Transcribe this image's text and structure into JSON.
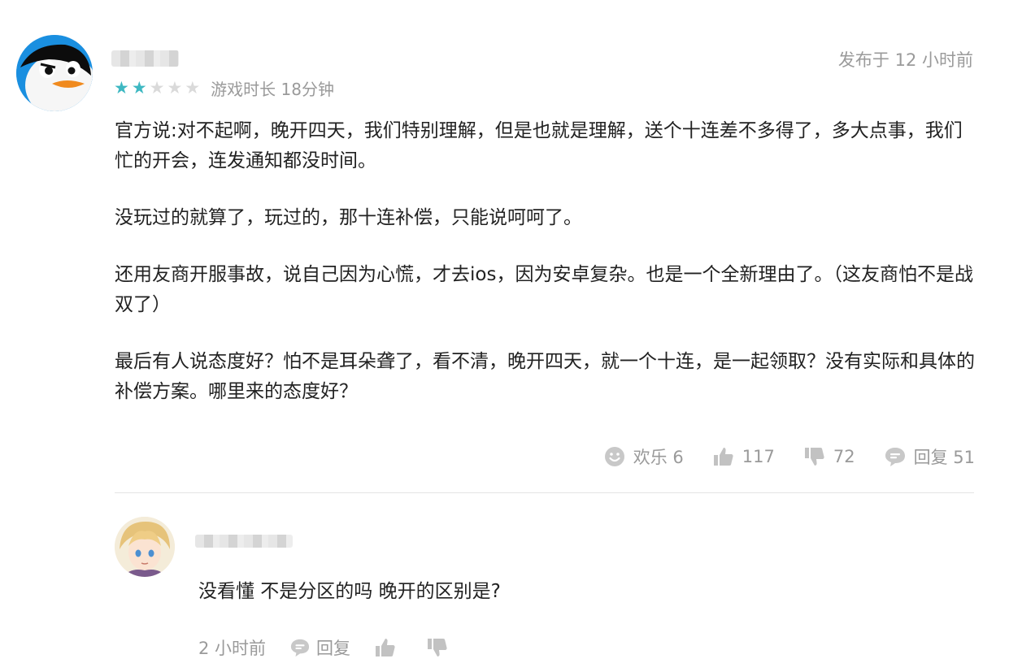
{
  "review": {
    "published": "发布于 12 小时前",
    "rating": {
      "value": 2,
      "max": 5
    },
    "playtime": "游戏时长 18分钟",
    "paragraphs": [
      "官方说:对不起啊，晚开四天，我们特别理解，但是也就是理解，送个十连差不多得了，多大点事，我们忙的开会，连发通知都没时间。",
      "没玩过的就算了，玩过的，那十连补偿，只能说呵呵了。",
      "还用友商开服事故，说自己因为心慌，才去ios，因为安卓复杂。也是一个全新理由了。（这友商怕不是战双了）",
      "最后有人说态度好？怕不是耳朵聋了，看不清，晚开四天，就一个十连，是一起领取？没有实际和具体的补偿方案。哪里来的态度好？"
    ],
    "actions": {
      "funny": "欢乐 6",
      "like": "117",
      "dislike": "72",
      "reply": "回复 51"
    }
  },
  "reply": {
    "text": "没看懂 不是分区的吗 晚开的区别是?",
    "time": "2 小时前",
    "reply_label": "回复"
  },
  "colors": {
    "star_on": "#3eb8c2",
    "star_off": "#dadada",
    "meta_text": "#9a9a9a",
    "icon": "#c2c2c2"
  }
}
